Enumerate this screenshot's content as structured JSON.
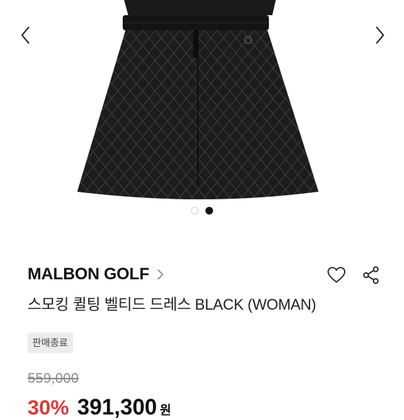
{
  "gallery": {
    "prev_icon": "chevron-left-icon",
    "next_icon": "chevron-right-icon",
    "slide_count": 2,
    "active_slide": 2
  },
  "product": {
    "brand": "MALBON GOLF",
    "name": "스모킹 퀼팅 벨티드 드레스 BLACK (WOMAN)",
    "status_badge": "판매종료",
    "original_price": "559,000",
    "discount_rate": "30%",
    "sale_price": "391,300",
    "currency": "원"
  },
  "actions": {
    "like_icon": "heart-icon",
    "share_icon": "share-icon"
  },
  "colors": {
    "discount": "#e03a3a",
    "badge_bg": "#ececec",
    "text": "#111111"
  }
}
